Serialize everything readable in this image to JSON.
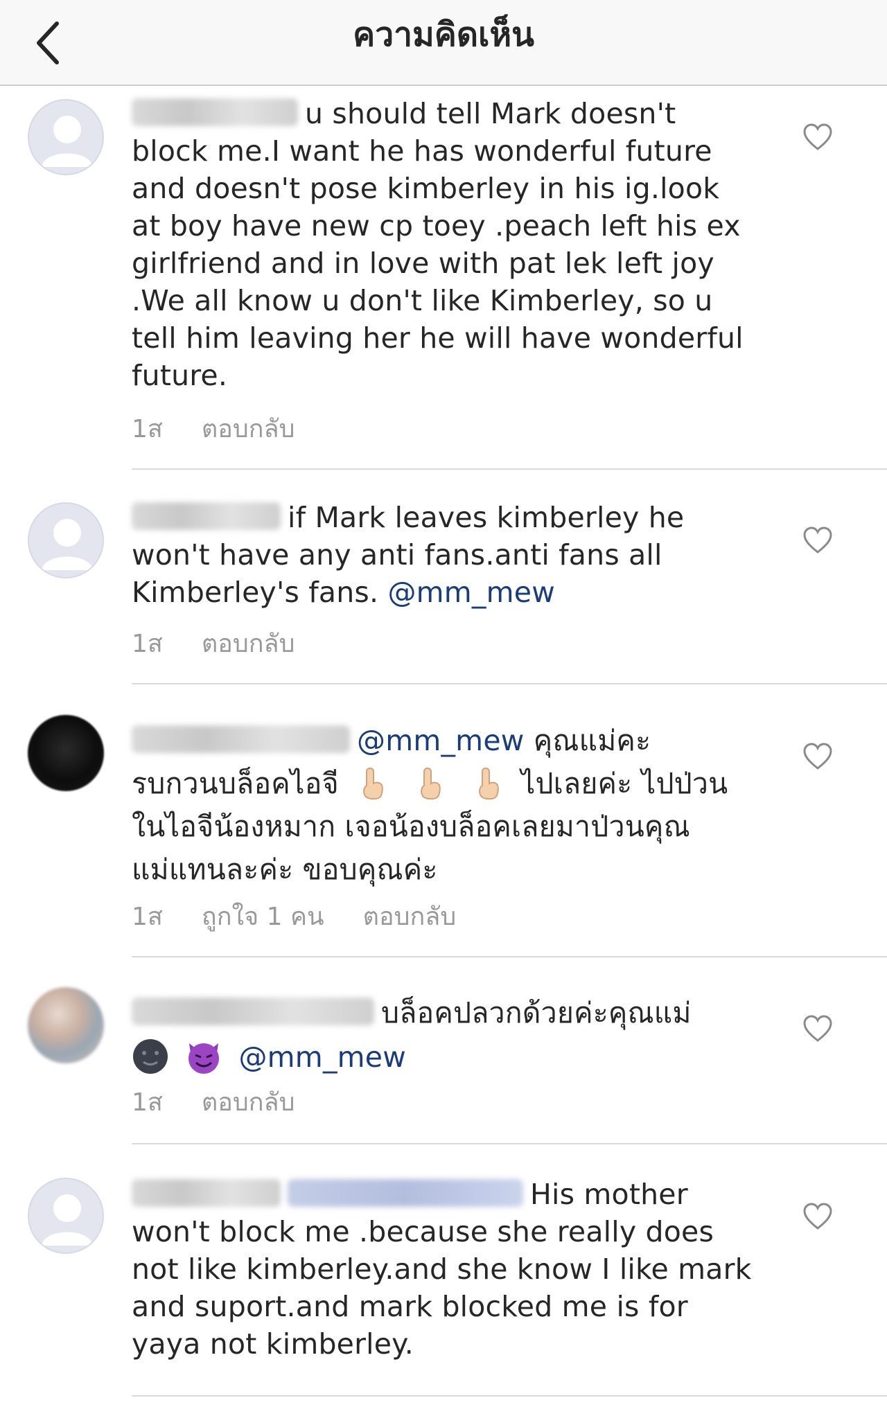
{
  "header": {
    "title": "ความคิดเห็น",
    "back_icon": "chevron-left-icon"
  },
  "comments": [
    {
      "text": "u should  tell  Mark doesn't block me.I want he has  wonderful future and doesn't  pose kimberley  in his ig.look at boy have new cp toey .peach left  his ex  girlfriend  and in love  with pat  lek left joy .We all know u don't  like Kimberley, so u tell him  leaving her he will have  wonderful  future.",
      "time": "1ส",
      "reply": "ตอบกลับ"
    },
    {
      "text": "if Mark leaves kimberley  he won't  have any anti fans.anti fans all Kimberley's fans.",
      "mention": "@mm_mew",
      "time": "1ส",
      "reply": "ตอบกลับ"
    },
    {
      "mention": "@mm_mew",
      "text_a": "คุณแม่คะ",
      "text_b": "รบกวนบล็อคไอจี",
      "text_c": "ไปเลยค่ะ ไปป่วน",
      "text_d": "ในไอจีน้องหมาก เจอน้องบล็อคเลยมาป่วนคุณ",
      "text_e": "แม่แทนละค่ะ ขอบคุณค่ะ",
      "time": "1ส",
      "likes": "ถูกใจ 1 คน",
      "reply": "ตอบกลับ"
    },
    {
      "text": "บล็อคปลวกด้วยค่ะคุณแม่",
      "mention": "@mm_mew",
      "time": "1ส",
      "reply": "ตอบกลับ"
    },
    {
      "text_a": "His mother",
      "text_b": "won't block me .because she really does not like kimberley.and she know I like mark and suport.and mark blocked me is for yaya not kimberley."
    }
  ],
  "colors": {
    "mention": "#1a3c7a",
    "meta_gray": "#999999",
    "text": "#262626",
    "header_bg": "#f8f8f8"
  },
  "icons": {
    "like": "heart-outline-icon",
    "avatar_default": "default-user-icon",
    "point_up": "point-up-emoji-icon",
    "moon_face": "new-moon-face-emoji-icon",
    "devil": "smiling-devil-emoji-icon"
  }
}
